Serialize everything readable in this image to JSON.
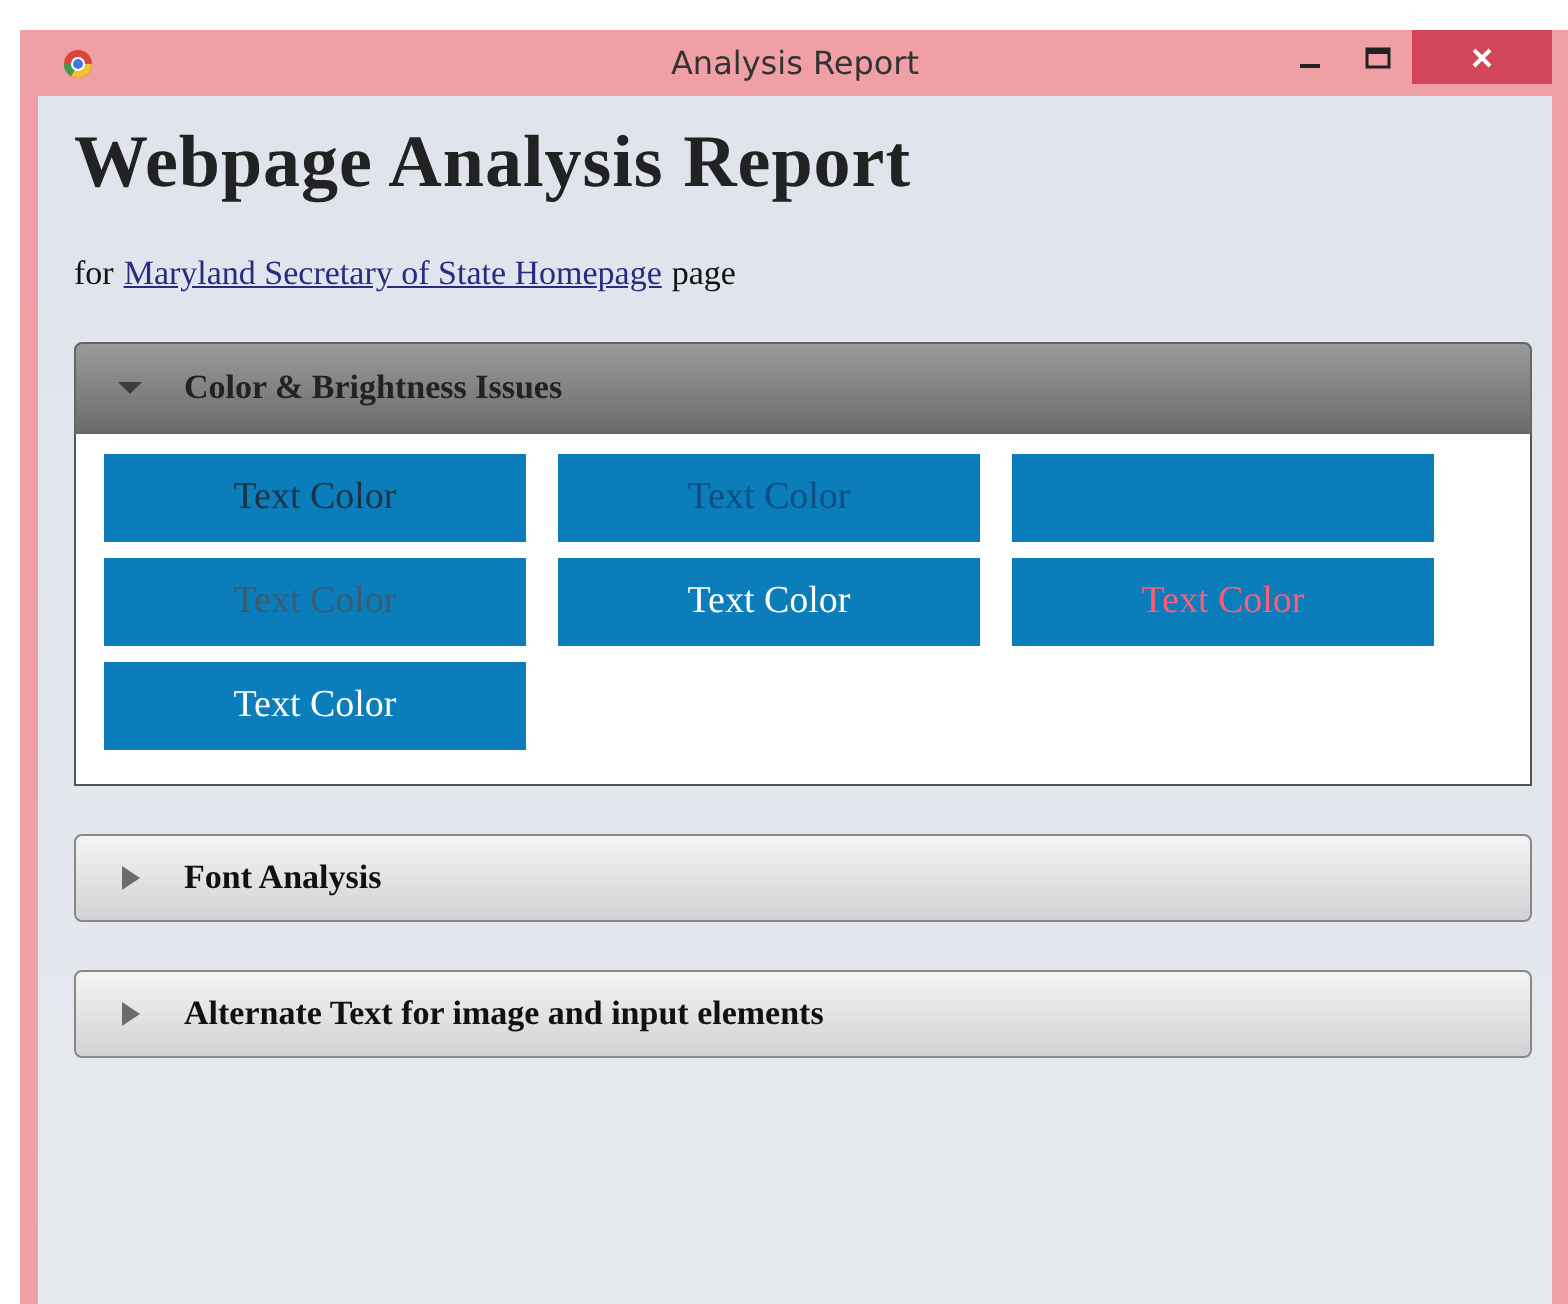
{
  "window": {
    "title": "Analysis Report"
  },
  "heading": "Webpage Analysis Report",
  "subtitle": {
    "before": "for",
    "link": "Maryland Secretary of State Homepage",
    "after": "page"
  },
  "sections": [
    {
      "title": "Color & Brightness Issues",
      "expanded": true,
      "swatches": [
        {
          "kind": "text",
          "text": "Text Color",
          "color": "#1c3346"
        },
        {
          "kind": "text",
          "text": "Text Color",
          "color": "#0b4f82"
        },
        {
          "kind": "blank"
        },
        {
          "kind": "text",
          "text": "Text Color",
          "color": "#3a5c6e"
        },
        {
          "kind": "text",
          "text": "Text Color",
          "color": "#ffffff"
        },
        {
          "kind": "text",
          "text": "Text Color",
          "color": "#ff5c78"
        },
        {
          "kind": "text",
          "text": "Text Color",
          "color": "#ffffff"
        }
      ]
    },
    {
      "title": "Font Analysis",
      "expanded": false
    },
    {
      "title": "Alternate Text for image and input elements",
      "expanded": false
    }
  ]
}
